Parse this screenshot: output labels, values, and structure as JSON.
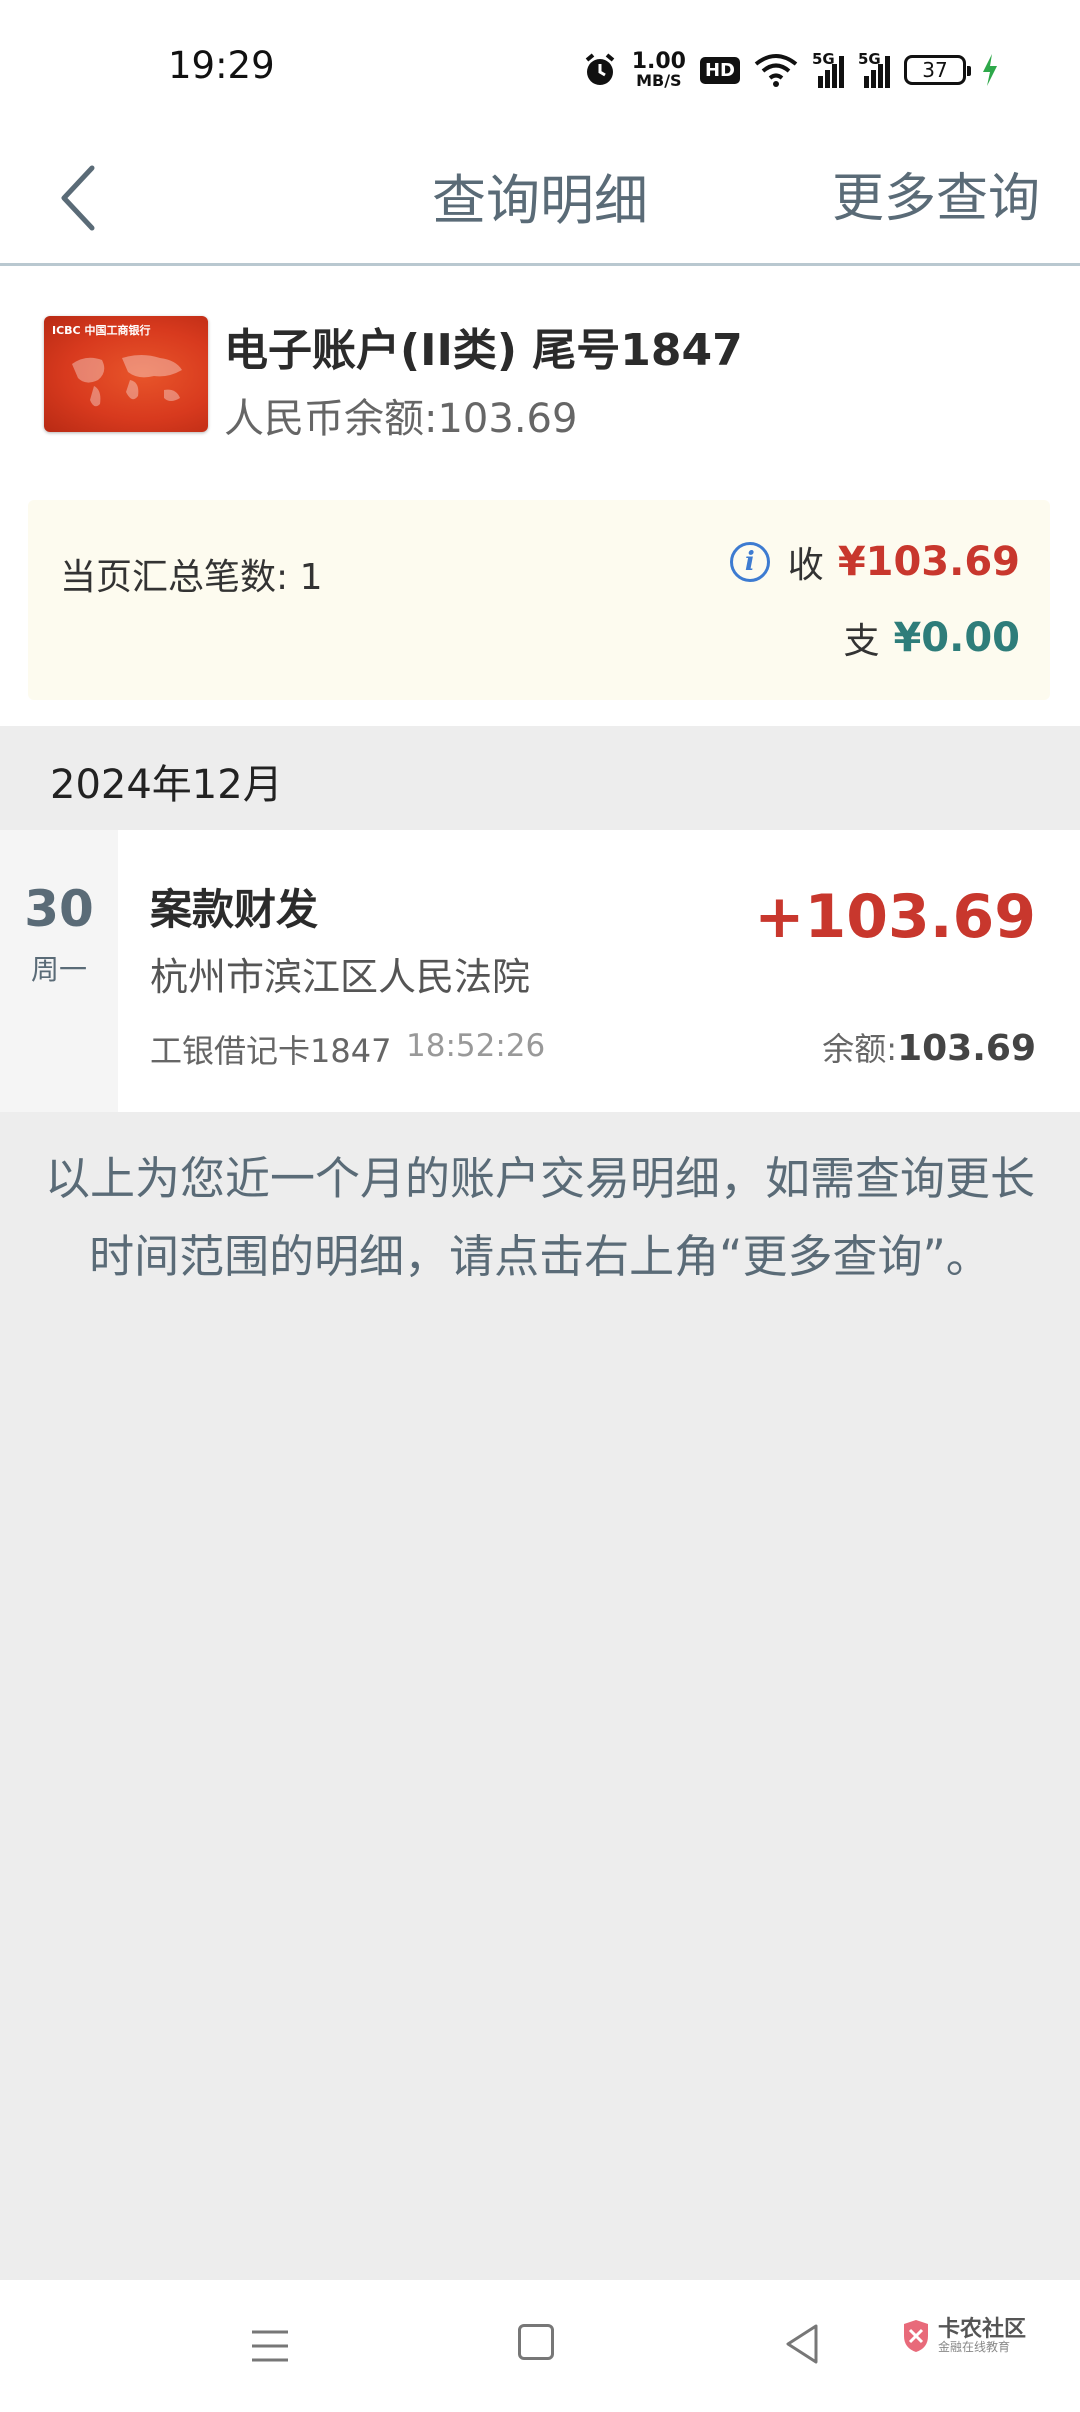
{
  "status_bar": {
    "time": "19:29",
    "network_speed_value": "1.00",
    "network_speed_unit": "MB/S",
    "hd_badge": "HD",
    "signal_1_label": "5G",
    "signal_2_label": "5G",
    "battery_level": "37",
    "icons": [
      "alarm-icon",
      "hd-icon",
      "wifi-icon",
      "signal-icon",
      "signal-icon",
      "battery-icon",
      "charging-icon"
    ]
  },
  "header": {
    "title": "查询明细",
    "more_query": "更多查询"
  },
  "account": {
    "card_bank_text": "ICBC 中国工商银行",
    "name": "电子账户(II类)  尾号1847",
    "balance": "人民币余额:103.69"
  },
  "summary": {
    "count_label": "当页汇总笔数: 1",
    "income_label": "收",
    "income_amount": "¥103.69",
    "expense_label": "支",
    "expense_amount": "¥0.00"
  },
  "month": {
    "label": "2024年12月"
  },
  "transactions": [
    {
      "day": "30",
      "weekday": "周一",
      "title": "案款财发",
      "counterparty": "杭州市滨江区人民法院",
      "card": "工银借记卡1847",
      "time": "18:52:26",
      "amount": "+103.69",
      "balance_label": "余额:",
      "balance_value": "103.69"
    }
  ],
  "note": "以上为您近一个月的账户交易明细，如需查询更长时间范围的明细，请点击右上角“更多查询”。",
  "watermark": {
    "title": "卡农社区",
    "subtitle": "金融在线教育"
  },
  "colors": {
    "income": "#c8372d",
    "expense": "#2e7d7a",
    "header_text": "#5a6b77",
    "info_icon": "#3d7bd1"
  }
}
